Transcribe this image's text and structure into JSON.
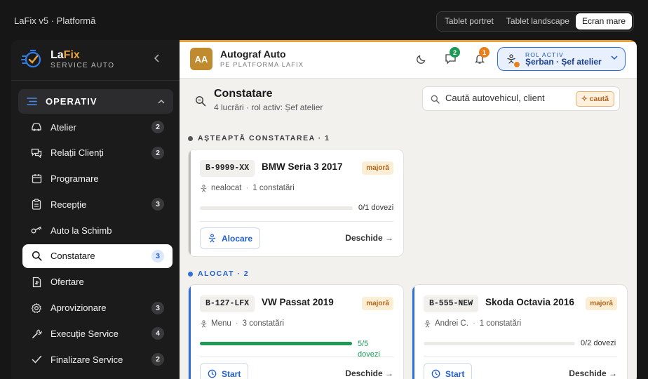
{
  "topbar": {
    "crumb": "LaFix v5 · Platformă",
    "modes": [
      "Tablet portret",
      "Tablet landscape",
      "Ecran mare"
    ],
    "active_mode": "Ecran mare"
  },
  "brand": {
    "name_a": "La",
    "name_b": "Fix",
    "tagline": "SERVICE AUTO"
  },
  "sidebar": {
    "group_label": "OPERATIV",
    "items": [
      {
        "label": "Atelier",
        "badge": "2",
        "icon": "car-icon"
      },
      {
        "label": "Relații Clienți",
        "badge": "2",
        "icon": "chat-icon"
      },
      {
        "label": "Programare",
        "badge": "",
        "icon": "calendar-icon"
      },
      {
        "label": "Recepție",
        "badge": "3",
        "icon": "clipboard-icon"
      },
      {
        "label": "Auto la Schimb",
        "badge": "",
        "icon": "key-icon"
      },
      {
        "label": "Constatare",
        "badge": "3",
        "icon": "search-icon",
        "active": true
      },
      {
        "label": "Ofertare",
        "badge": "",
        "icon": "document-icon"
      },
      {
        "label": "Aprovizionare",
        "badge": "3",
        "icon": "gear-icon"
      },
      {
        "label": "Execuție Service",
        "badge": "4",
        "icon": "wrench-icon"
      },
      {
        "label": "Finalizare Service",
        "badge": "2",
        "icon": "check-icon"
      }
    ]
  },
  "header": {
    "avatar": "AA",
    "org_name": "Autograf Auto",
    "org_sub": "PE PLATFORMA LAFIX",
    "messages_count": "2",
    "notifications_count": "1",
    "role_key": "ROL ACTIV",
    "role_value": "Șerban · Șef atelier"
  },
  "page": {
    "title": "Constatare",
    "subtitle": "4 lucrări · rol activ: Șef atelier",
    "search_placeholder": "Caută autovehicul, client",
    "search_button": "✧ caută"
  },
  "colors": {
    "accent": "#e9a23b",
    "blue": "#2f6ddb",
    "green": "#1f9a55",
    "grey_dot": "#555555"
  },
  "sections": [
    {
      "label": "AȘTEAPTĂ CONSTATAREA · 1",
      "cards": [
        {
          "plate": "B-9999-XX",
          "car": "BMW Seria 3 2017",
          "tag": "majoră",
          "person": "nealocat",
          "findings": "1 constatări",
          "progress": 0,
          "progress_label": "0/1 dovezi",
          "action": "Alocare",
          "open": "Deschide →"
        }
      ]
    },
    {
      "label": "ALOCAT · 2",
      "cards": [
        {
          "plate": "B-127-LFX",
          "car": "VW Passat 2019",
          "tag": "majoră",
          "person": "Menu",
          "findings": "3 constatări",
          "progress": 1,
          "progress_label": "5/5 dovezi",
          "action": "Start",
          "open": "Deschide →"
        },
        {
          "plate": "B-555-NEW",
          "car": "Skoda Octavia 2016",
          "tag": "majoră",
          "person": "Andrei C.",
          "findings": "1 constatări",
          "progress": 0,
          "progress_label": "0/2 dovezi",
          "action": "Start",
          "open": "Deschide →"
        }
      ]
    }
  ]
}
